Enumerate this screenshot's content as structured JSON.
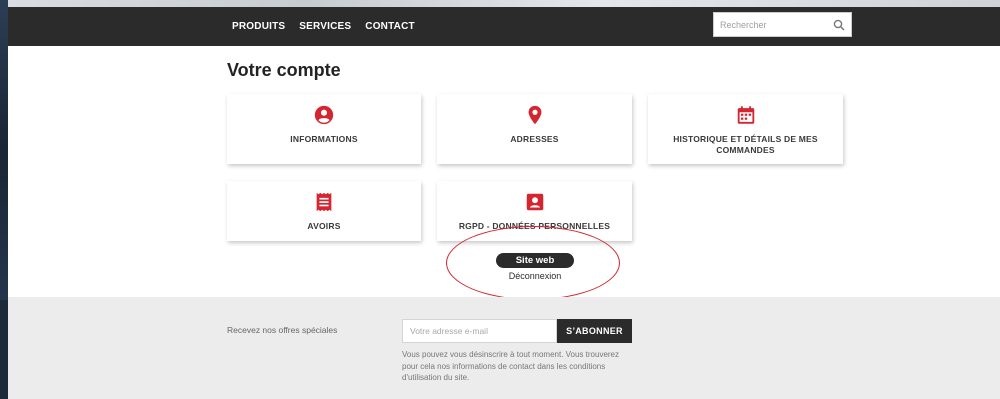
{
  "nav": {
    "links": [
      "PRODUITS",
      "SERVICES",
      "CONTACT"
    ],
    "search_placeholder": "Rechercher"
  },
  "main": {
    "title": "Votre compte",
    "cards": [
      {
        "label": "INFORMATIONS",
        "icon": "user-circle-icon"
      },
      {
        "label": "ADRESSES",
        "icon": "map-pin-icon"
      },
      {
        "label": "HISTORIQUE ET DÉTAILS DE MES COMMANDES",
        "icon": "calendar-icon"
      },
      {
        "label": "AVOIRS",
        "icon": "receipt-icon"
      },
      {
        "label": "RGPD - DONNÉES PERSONNELLES",
        "icon": "contact-card-icon"
      }
    ],
    "site_web_label": "Site web",
    "logout_label": "Déconnexion"
  },
  "footer": {
    "newsletter_label": "Recevez nos offres spéciales",
    "email_placeholder": "Votre adresse e-mail",
    "subscribe_label": "S’ABONNER",
    "disclaimer": "Vous pouvez vous désinscrire à tout moment. Vous trouverez pour cela nos informations de contact dans les conditions d'utilisation du site."
  },
  "colors": {
    "accent": "#d42530",
    "navbar": "#2b2b2b",
    "footer_bg": "#ececec"
  }
}
